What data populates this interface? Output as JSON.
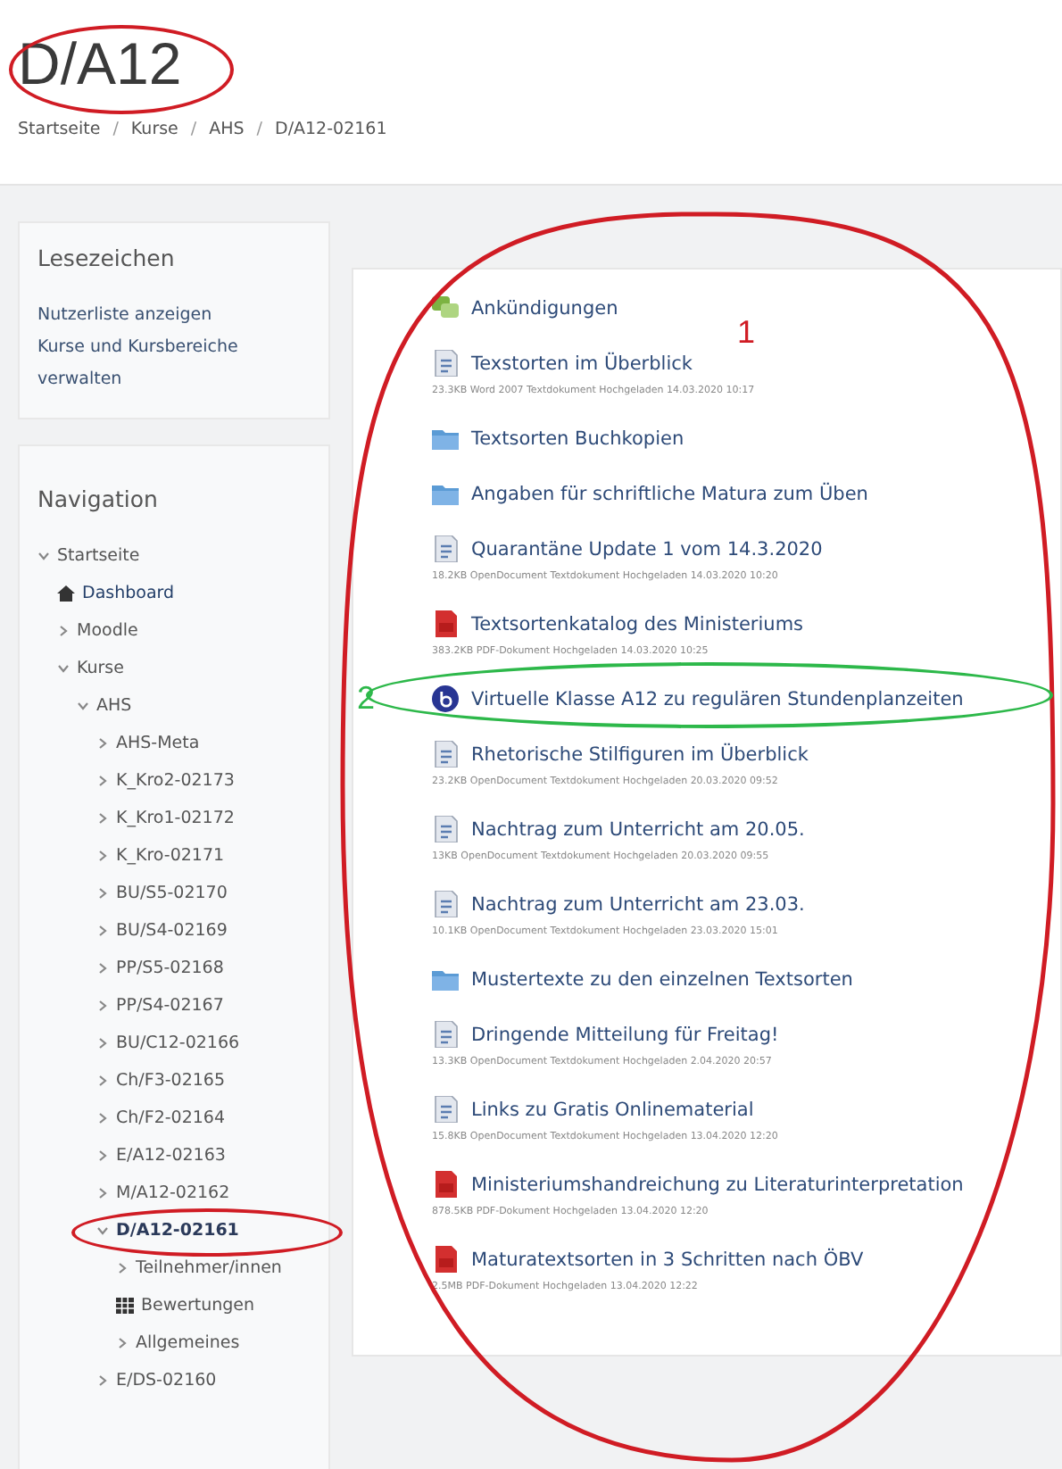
{
  "header": {
    "title": "D/A12",
    "breadcrumb_separator": "/",
    "breadcrumb": [
      "Startseite",
      "Kurse",
      "AHS",
      "D/A12-02161"
    ]
  },
  "bookmarks": {
    "title": "Lesezeichen",
    "links": [
      "Nutzerliste anzeigen",
      "Kurse und Kursbereiche verwalten"
    ]
  },
  "navigation": {
    "title": "Navigation",
    "items": [
      {
        "label": "Startseite",
        "kind": "branch",
        "expanded": true,
        "children": [
          {
            "label": "Dashboard",
            "kind": "home"
          },
          {
            "label": "Moodle",
            "kind": "branch",
            "expanded": false
          },
          {
            "label": "Kurse",
            "kind": "branch",
            "expanded": true,
            "children": [
              {
                "label": "AHS",
                "kind": "branch",
                "expanded": true,
                "children": [
                  {
                    "label": "AHS-Meta",
                    "kind": "branch",
                    "expanded": false
                  },
                  {
                    "label": "K_Kro2-02173",
                    "kind": "branch",
                    "expanded": false
                  },
                  {
                    "label": "K_Kro1-02172",
                    "kind": "branch",
                    "expanded": false
                  },
                  {
                    "label": "K_Kro-02171",
                    "kind": "branch",
                    "expanded": false
                  },
                  {
                    "label": "BU/S5-02170",
                    "kind": "branch",
                    "expanded": false
                  },
                  {
                    "label": "BU/S4-02169",
                    "kind": "branch",
                    "expanded": false
                  },
                  {
                    "label": "PP/S5-02168",
                    "kind": "branch",
                    "expanded": false
                  },
                  {
                    "label": "PP/S4-02167",
                    "kind": "branch",
                    "expanded": false
                  },
                  {
                    "label": "BU/C12-02166",
                    "kind": "branch",
                    "expanded": false
                  },
                  {
                    "label": "Ch/F3-02165",
                    "kind": "branch",
                    "expanded": false
                  },
                  {
                    "label": "Ch/F2-02164",
                    "kind": "branch",
                    "expanded": false
                  },
                  {
                    "label": "E/A12-02163",
                    "kind": "branch",
                    "expanded": false
                  },
                  {
                    "label": "M/A12-02162",
                    "kind": "branch",
                    "expanded": false
                  },
                  {
                    "label": "D/A12-02161",
                    "kind": "branch",
                    "expanded": true,
                    "current": true,
                    "children": [
                      {
                        "label": "Teilnehmer/innen",
                        "kind": "branch",
                        "expanded": false
                      },
                      {
                        "label": "Bewertungen",
                        "kind": "grades"
                      },
                      {
                        "label": "Allgemeines",
                        "kind": "branch",
                        "expanded": false
                      }
                    ]
                  },
                  {
                    "label": "E/DS-02160",
                    "kind": "branch",
                    "expanded": false
                  }
                ]
              }
            ]
          }
        ]
      }
    ]
  },
  "activities": [
    {
      "kind": "forum",
      "title": "Ankündigungen"
    },
    {
      "kind": "document",
      "title": "Texstorten im Überblick",
      "meta": "23.3KB Word 2007 Textdokument Hochgeladen 14.03.2020 10:17"
    },
    {
      "kind": "folder",
      "title": "Textsorten Buchkopien"
    },
    {
      "kind": "folder",
      "title": "Angaben für schriftliche Matura zum Üben"
    },
    {
      "kind": "document",
      "title": "Quarantäne Update 1 vom 14.3.2020",
      "meta": "18.2KB OpenDocument Textdokument Hochgeladen 14.03.2020 10:20"
    },
    {
      "kind": "pdf",
      "title": "Textsortenkatalog des Ministeriums",
      "meta": "383.2KB PDF-Dokument Hochgeladen 14.03.2020 10:25"
    },
    {
      "kind": "conference",
      "title": "Virtuelle Klasse A12 zu regulären Stundenplanzeiten"
    },
    {
      "kind": "document",
      "title": "Rhetorische Stilfiguren im Überblick",
      "meta": "23.2KB OpenDocument Textdokument Hochgeladen 20.03.2020 09:52"
    },
    {
      "kind": "document",
      "title": "Nachtrag zum Unterricht am 20.05.",
      "meta": "13KB OpenDocument Textdokument Hochgeladen 20.03.2020 09:55"
    },
    {
      "kind": "document",
      "title": "Nachtrag zum Unterricht am 23.03.",
      "meta": "10.1KB OpenDocument Textdokument Hochgeladen 23.03.2020 15:01"
    },
    {
      "kind": "folder",
      "title": "Mustertexte zu den einzelnen Textsorten"
    },
    {
      "kind": "document",
      "title": "Dringende Mitteilung für Freitag!",
      "meta": "13.3KB OpenDocument Textdokument Hochgeladen 2.04.2020 20:57"
    },
    {
      "kind": "document",
      "title": "Links zu Gratis Onlinematerial",
      "meta": "15.8KB OpenDocument Textdokument Hochgeladen 13.04.2020 12:20"
    },
    {
      "kind": "pdf",
      "title": "Ministeriumshandreichung zu Literaturinterpretation",
      "meta": "878.5KB PDF-Dokument Hochgeladen 13.04.2020 12:20"
    },
    {
      "kind": "pdf",
      "title": "Maturatextsorten in 3 Schritten nach ÖBV",
      "meta": "2.5MB PDF-Dokument Hochgeladen 13.04.2020 12:22"
    }
  ],
  "annotations": [
    {
      "kind": "ellipse",
      "color": "#d01c24"
    },
    {
      "kind": "egg",
      "color": "#d01c24"
    },
    {
      "kind": "label",
      "text": "1",
      "color": "#d01c24"
    },
    {
      "kind": "ellipse",
      "color": "#2db84a"
    },
    {
      "kind": "label",
      "text": "2",
      "color": "#2db84a"
    },
    {
      "kind": "ellipse",
      "color": "#d01c24"
    }
  ]
}
